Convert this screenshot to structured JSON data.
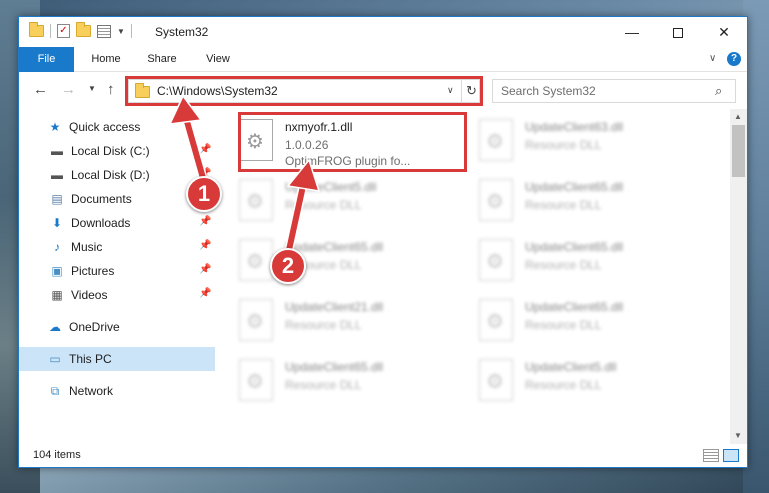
{
  "window": {
    "title": "System32",
    "minimize_glyph": "—",
    "close_glyph": "✕"
  },
  "ribbon": {
    "tabs": [
      "File",
      "Home",
      "Share",
      "View"
    ],
    "help_glyph": "?"
  },
  "address": {
    "path": "C:\\Windows\\System32",
    "refresh_glyph": "↻"
  },
  "search": {
    "placeholder": "Search System32"
  },
  "sidebar": {
    "items": [
      {
        "label": "Quick access",
        "icon": "star-icon",
        "pinned": false
      },
      {
        "label": "Local Disk (C:)",
        "icon": "drive-icon",
        "pinned": true
      },
      {
        "label": "Local Disk (D:)",
        "icon": "drive-icon",
        "pinned": true
      },
      {
        "label": "Documents",
        "icon": "documents-icon",
        "pinned": true
      },
      {
        "label": "Downloads",
        "icon": "download-icon",
        "pinned": true
      },
      {
        "label": "Music",
        "icon": "music-icon",
        "pinned": true
      },
      {
        "label": "Pictures",
        "icon": "pictures-icon",
        "pinned": true
      },
      {
        "label": "Videos",
        "icon": "videos-icon",
        "pinned": true
      },
      {
        "label": "OneDrive",
        "icon": "cloud-icon",
        "pinned": false
      },
      {
        "label": "This PC",
        "icon": "computer-icon",
        "pinned": false,
        "selected": true
      },
      {
        "label": "Network",
        "icon": "network-icon",
        "pinned": false
      }
    ]
  },
  "files": {
    "highlighted": {
      "name": "nxmyofr.1.dll",
      "version": "1.0.0.26",
      "description": "OptimFROG plugin fo..."
    },
    "blurred": [
      {
        "name": "UpdateClient63.dll",
        "type": "Resource DLL"
      },
      {
        "name": "UpdateClient5.dll",
        "type": "Resource DLL"
      },
      {
        "name": "UpdateClient65.dll",
        "type": "Resource DLL"
      },
      {
        "name": "UpdateClient65.dll",
        "type": "Resource DLL"
      },
      {
        "name": "UpdateClient65.dll",
        "type": "Resource DLL"
      },
      {
        "name": "UpdateClient21.dll",
        "type": "Resource DLL"
      },
      {
        "name": "UpdateClient65.dll",
        "type": "Resource DLL"
      },
      {
        "name": "UpdateClient65.dll",
        "type": "Resource DLL"
      },
      {
        "name": "UpdateClient5.dll",
        "type": "Resource DLL"
      }
    ]
  },
  "status": {
    "item_count": "104 items"
  },
  "annotations": {
    "markers": [
      "1",
      "2"
    ],
    "color": "#d83a3a"
  }
}
